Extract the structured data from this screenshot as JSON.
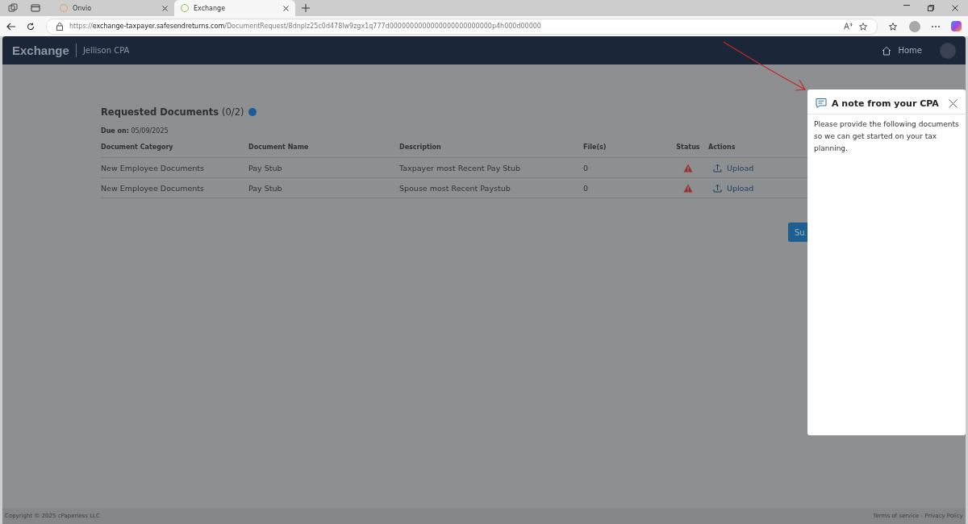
{
  "browser": {
    "tabs": [
      {
        "title": "Onvio",
        "selected": false
      },
      {
        "title": "Exchange",
        "selected": true
      }
    ],
    "url": {
      "scheme": "https://",
      "host": "exchange-taxpayer.safesendreturns.com",
      "path": "/DocumentRequest/8dnplz25c0d478lw9zgx1q777d0000000000000000000000000p4h000d00000"
    }
  },
  "header": {
    "brand": "Exchange",
    "firm": "Jellison CPA",
    "home": "Home"
  },
  "requests": {
    "title": "Requested Documents",
    "count": "(0/2)",
    "due_label": "Due on:",
    "due_date": "05/09/2025",
    "columns": [
      "Document Category",
      "Document Name",
      "Description",
      "File(s)",
      "Status",
      "Actions"
    ],
    "rows": [
      {
        "category": "New Employee Documents",
        "name": "Pay Stub",
        "description": "Taxpayer most Recent Pay Stub",
        "files": "0",
        "warning": true,
        "action": "Upload"
      },
      {
        "category": "New Employee Documents",
        "name": "Pay Stub",
        "description": "Spouse most Recent Paystub",
        "files": "0",
        "warning": true,
        "action": "Upload"
      }
    ],
    "submit": "Su"
  },
  "note": {
    "title": "A note from your CPA",
    "body": "Please provide the following documents so we can get started on your tax planning."
  },
  "footer": {
    "copyright": "Copyright © 2025 cPaperless LLC",
    "links": "Terms of service - Privacy Policy"
  }
}
